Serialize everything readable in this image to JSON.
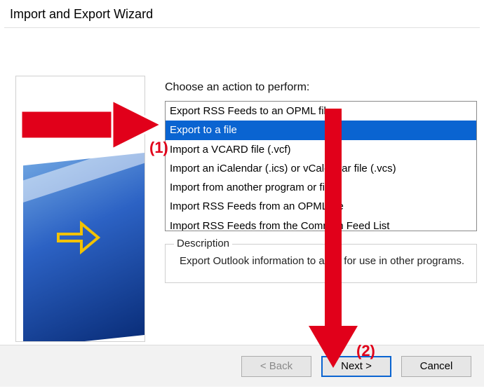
{
  "window": {
    "title": "Import and Export Wizard"
  },
  "main": {
    "prompt": "Choose an action to perform:",
    "actions": [
      "Export RSS Feeds to an OPML file",
      "Export to a file",
      "Import a VCARD file (.vcf)",
      "Import an iCalendar (.ics) or vCalendar file (.vcs)",
      "Import from another program or file",
      "Import RSS Feeds from an OPML file",
      "Import RSS Feeds from the Common Feed List"
    ],
    "selected_index": 1,
    "description_label": "Description",
    "description_text": "Export Outlook information to a file for use in other programs."
  },
  "footer": {
    "back": "< Back",
    "next": "Next >",
    "cancel": "Cancel"
  },
  "annotations": {
    "label1": "(1)",
    "label2": "(2)"
  }
}
